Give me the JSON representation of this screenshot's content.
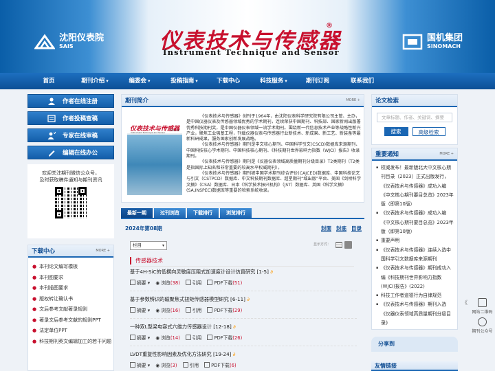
{
  "header": {
    "left_logo": {
      "cn": "沈阳仪表院",
      "en": "SAIS"
    },
    "title_cn": "仪表技术与传感器",
    "registered": "®",
    "title_en": "Instrument Technique and Sensor",
    "right_logo": {
      "cn": "国机集团",
      "en": "SINOMACH"
    }
  },
  "nav": [
    {
      "label": "首页",
      "caret": ""
    },
    {
      "label": "期刊介绍",
      "caret": "▾"
    },
    {
      "label": "编委会",
      "caret": "▾"
    },
    {
      "label": "投稿指南",
      "caret": "▾"
    },
    {
      "label": "下载中心",
      "caret": ""
    },
    {
      "label": "科技服务",
      "caret": "▾"
    },
    {
      "label": "期刊订阅",
      "caret": ""
    },
    {
      "label": "联系我们",
      "caret": ""
    }
  ],
  "left_buttons": [
    "作者在线注册",
    "作者投稿查稿",
    "专家在线审稿",
    "编辑在线办公"
  ],
  "promo": {
    "line1": "欢迎关注期刊微信公众号，",
    "line2": "及时获取稿件通知与期刊资讯"
  },
  "download": {
    "title": "下载中心",
    "more": "MORE +",
    "items": [
      "本刊论文编写模板",
      "本刊图要求",
      "本刊插图要求",
      "版权转让确认书",
      "文后参考文献著录规则",
      "著录文后参考文献的规则PPT",
      "法定单位PPT",
      "科技期刊英文编辑加工的若干问题"
    ]
  },
  "intro": {
    "title": "期刊简介",
    "more": "MORE +",
    "cover_title": "仪表技术与传感器",
    "cover_en": "Instrument Technique and Sensor",
    "cover_year": "2024.08",
    "paragraphs": [
      "《仪表技术与传感器》创刊于1964年，由沈阳仪表科学研究院有限公司主管、主办，是中国仪器仪表及传感器领域优秀的学术期刊，连续荣获中国期刊、科技部、国家新闻出版署优秀科技期刊奖，是中国仪器仪表领域一流学术期刊。围绕新一代信息技术产业等战略性新兴产业，聚焦工业强基工程，刊载仪器仪表与传感器行业新技术、新成果、新工艺、新装备等最新科研成果，服务国家创新发展战略。",
      "《仪表技术与传感器》期刊是中文核心期刊、中国科学引文(CSCD)数据库来源期刊、中国科技核心学术期刊、中国科技核心期刊、《科技期刊世界影响力指数（WJCI）报告》收录期刊。",
      "《仪表技术与传感器》期刊是《仪器仪表领域高质量期刊分级目录》T2类期刊（T2类是指国际上知名和非常重要的较高水平权威期刊）。",
      "《仪表技术与传感器》期刊被中国学术期刊综合评价(CAJCED)数据库、中国科技论文与引文（CSTPCD）数据库、中文科技期刊数据库、超星期刊“域出版”平台、美国《剑桥科学文摘》（CSA）数据库、日本《科学技术振兴机构》（JST）数据库、英国《科学文摘》(SA,INSPEC)数据库等重要的检索系统收录。"
    ]
  },
  "tabs": [
    "最新一期",
    "过刊浏览",
    "下载排行",
    "浏览排行"
  ],
  "issue": {
    "label": "2024年第08期",
    "links": [
      "封面",
      "封底",
      "目录"
    ]
  },
  "toolbar": {
    "select": "栏目",
    "view_label": "显示方式："
  },
  "section": "传感器技术",
  "articles": [
    {
      "title": "基于4H-SiC的低横向灵敏度压阻式加速度计设计仿真研究 [1-5]",
      "abstract": "摘要",
      "views_label": "浏览",
      "views": "(38)",
      "cite": "引用",
      "pdf": "PDF下载",
      "downloads": "(51)"
    },
    {
      "title": "基于参数辨识的磁聚焦式扭矩传感器模型研究 [6-11]",
      "abstract": "摘要",
      "views_label": "浏览",
      "views": "(16)",
      "cite": "引用",
      "pdf": "PDF下载",
      "downloads": "(29)"
    },
    {
      "title": "一种双L型梁电容式六维力传感器设计 [12-18]",
      "abstract": "摘要",
      "views_label": "浏览",
      "views": "(14)",
      "cite": "引用",
      "pdf": "PDF下载",
      "downloads": "(26)"
    },
    {
      "title": "LVDT重复性影响因素及优化方法研究 [19-24]",
      "abstract": "摘要",
      "views_label": "浏览",
      "views": "(3)",
      "cite": "引用",
      "pdf": "PDF下载",
      "downloads": "(6)"
    }
  ],
  "search": {
    "title": "论文检索",
    "placeholder": "文章标题、作者、关键词、摘要",
    "search_btn": "搜索",
    "advanced_btn": "高级检索"
  },
  "notice": {
    "title": "重要通知",
    "more": "MORE +",
    "items": [
      "权威发布！最新版北大中文核心期刊目录（2023）正式出版发行，《仪表技术与传感器》成功入编《中文核心期刊要目总览》2023年版（即第10版）",
      "《仪表技术与传感器》成功入编《中文核心期刊要目总览》2023年版（即第10版）",
      "重要声明",
      "《仪表技术与传感器》连续入选中国科学引文数据库来源期刊",
      "《仪表技术与传感器》期刊成功入编《科技期刊世界影响力指数(WJCI)报告》(2022)",
      "科技工作者道德行为自律规范",
      "《仪表技术与传感器》期刊入选《仪器仪表领域高质量期刊分级目录》"
    ]
  },
  "share": "分享到",
  "links_title": "友情链接",
  "float": {
    "qr_label": "网站二维码",
    "wechat_label": "期刊公众号",
    "collapse": "《"
  }
}
